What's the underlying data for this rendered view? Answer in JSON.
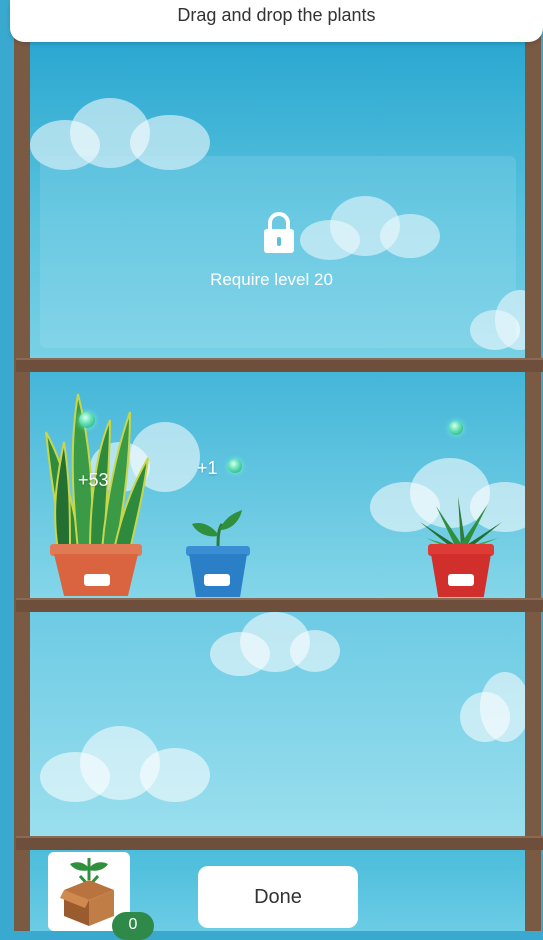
{
  "header": {
    "instruction": "Drag and drop the plants"
  },
  "locked_shelf": {
    "message": "Require level 20",
    "icon": "lock-icon"
  },
  "plants": [
    {
      "type": "snake-plant",
      "pot_color": "#d9643f",
      "floating_text": "+53"
    },
    {
      "type": "sprout",
      "pot_color": "#2a7fc6",
      "floating_text": "+1"
    },
    {
      "type": "aloe",
      "pot_color": "#d12f2b"
    }
  ],
  "inventory": {
    "icon": "seed-box-icon",
    "count": "0"
  },
  "done_button": {
    "label": "Done"
  },
  "colors": {
    "wood": "#7b5a43",
    "sky": "#3aa9cf",
    "badge": "#2f8a4a"
  }
}
